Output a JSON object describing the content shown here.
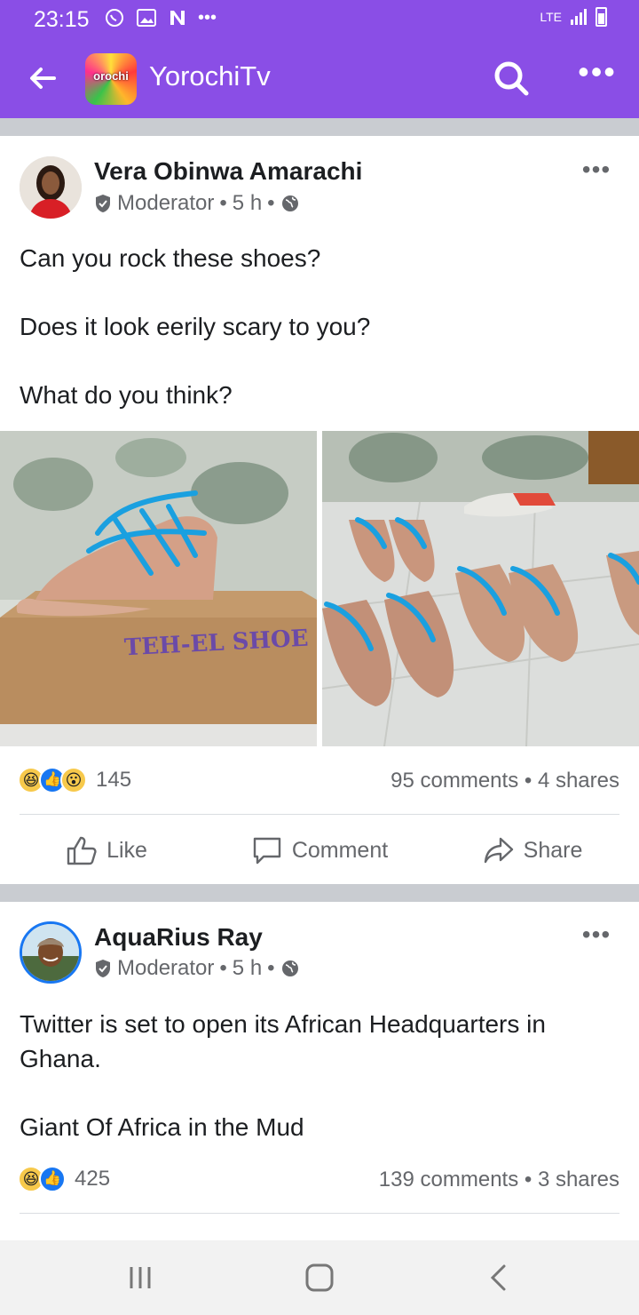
{
  "status": {
    "time": "23:15",
    "network": "LTE"
  },
  "app": {
    "group_name": "YorochiTv",
    "logo_text": "orochi"
  },
  "posts": [
    {
      "author": "Vera Obinwa Amarachi",
      "role": "Moderator",
      "time": "5 h",
      "lines": [
        "Can you rock these shoes?",
        "Does it look eerily scary to you?",
        "What do you think?"
      ],
      "photo_box_text": "TEH-EL SHOE",
      "reaction_count": "145",
      "stats": "95 comments • 4 shares"
    },
    {
      "author": "AquaRius Ray",
      "role": "Moderator",
      "time": "5 h",
      "lines": [
        "Twitter is set to open its African Headquarters in Ghana.",
        "Giant Of Africa in the Mud"
      ],
      "reaction_count": "425",
      "stats": "139 comments • 3 shares"
    }
  ],
  "actions": {
    "like": "Like",
    "comment": "Comment",
    "share": "Share"
  },
  "colors": {
    "brand": "#8a4ee6",
    "like_blue": "#1877f2",
    "meta_gray": "#65676b"
  },
  "icons": [
    "whatsapp-icon",
    "gallery-icon",
    "n-icon",
    "search-icon",
    "shield-icon",
    "globe-icon",
    "like-icon",
    "comment-icon",
    "share-icon"
  ]
}
